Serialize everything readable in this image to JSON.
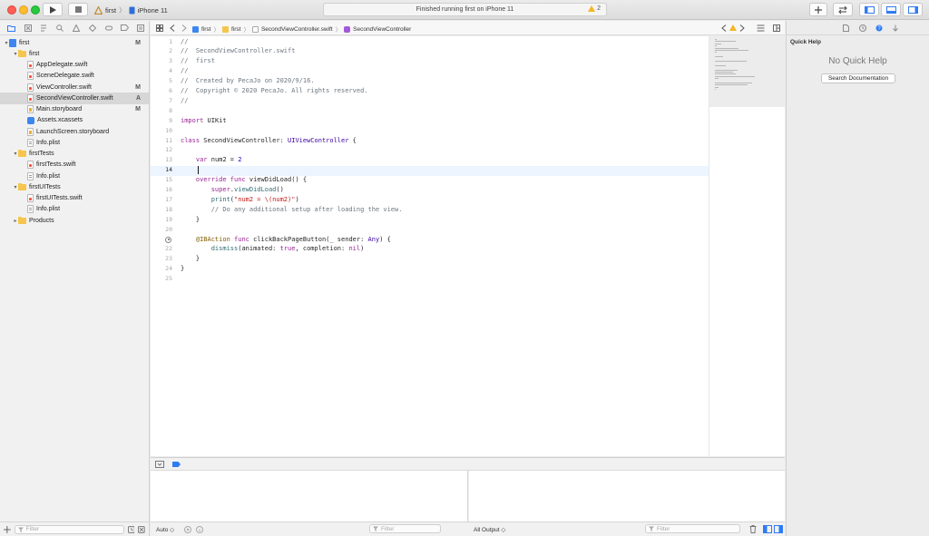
{
  "toolbar": {
    "scheme_name": "first",
    "device_name": "iPhone 11",
    "status": "Finished running first on iPhone 11",
    "warning_count": "2"
  },
  "navigator": {
    "filter_placeholder": "Filter",
    "items": [
      {
        "label": "first",
        "badge": "M",
        "level": 0,
        "kind": "project",
        "open": true
      },
      {
        "label": "first",
        "badge": "",
        "level": 1,
        "kind": "folder",
        "open": true
      },
      {
        "label": "AppDelegate.swift",
        "badge": "",
        "level": 2,
        "kind": "swift"
      },
      {
        "label": "SceneDelegate.swift",
        "badge": "",
        "level": 2,
        "kind": "swift"
      },
      {
        "label": "ViewController.swift",
        "badge": "M",
        "level": 2,
        "kind": "swift"
      },
      {
        "label": "SecondViewController.swift",
        "badge": "A",
        "level": 2,
        "kind": "swift",
        "selected": true
      },
      {
        "label": "Main.storyboard",
        "badge": "M",
        "level": 2,
        "kind": "story"
      },
      {
        "label": "Assets.xcassets",
        "badge": "",
        "level": 2,
        "kind": "assets"
      },
      {
        "label": "LaunchScreen.storyboard",
        "badge": "",
        "level": 2,
        "kind": "story"
      },
      {
        "label": "Info.plist",
        "badge": "",
        "level": 2,
        "kind": "plist"
      },
      {
        "label": "firstTests",
        "badge": "",
        "level": 1,
        "kind": "folder",
        "open": true
      },
      {
        "label": "firstTests.swift",
        "badge": "",
        "level": 2,
        "kind": "swift"
      },
      {
        "label": "Info.plist",
        "badge": "",
        "level": 2,
        "kind": "plist"
      },
      {
        "label": "firstUITests",
        "badge": "",
        "level": 1,
        "kind": "folder",
        "open": true
      },
      {
        "label": "firstUITests.swift",
        "badge": "",
        "level": 2,
        "kind": "swift"
      },
      {
        "label": "Info.plist",
        "badge": "",
        "level": 2,
        "kind": "plist"
      },
      {
        "label": "Products",
        "badge": "",
        "level": 1,
        "kind": "folder",
        "open": false
      }
    ]
  },
  "jumpbar": {
    "crumbs": [
      "first",
      "first",
      "SecondViewController.swift",
      "SecondViewController"
    ]
  },
  "editor": {
    "current_line": 14,
    "breakpoint_line": 21,
    "lines": [
      [
        [
          "c-cm",
          "//"
        ]
      ],
      [
        [
          "c-cm",
          "//  SecondViewController.swift"
        ]
      ],
      [
        [
          "c-cm",
          "//  first"
        ]
      ],
      [
        [
          "c-cm",
          "//"
        ]
      ],
      [
        [
          "c-cm",
          "//  Created by PecaJo on 2020/9/16."
        ]
      ],
      [
        [
          "c-cm",
          "//  Copyright © 2020 PecaJo. All rights reserved."
        ]
      ],
      [
        [
          "c-cm",
          "//"
        ]
      ],
      [],
      [
        [
          "c-kw",
          "import"
        ],
        [
          "",
          " UIKit"
        ]
      ],
      [],
      [
        [
          "c-kw",
          "class"
        ],
        [
          "",
          " SecondViewController: "
        ],
        [
          "c-ty",
          "UIViewController"
        ],
        [
          "",
          " {"
        ]
      ],
      [],
      [
        [
          "",
          "    "
        ],
        [
          "c-kw",
          "var"
        ],
        [
          "",
          " num2 = "
        ],
        [
          "c-num",
          "2"
        ]
      ],
      [],
      [
        [
          "",
          "    "
        ],
        [
          "c-kw",
          "override func"
        ],
        [
          "",
          " viewDidLoad() {"
        ]
      ],
      [
        [
          "",
          "        "
        ],
        [
          "c-kw",
          "super"
        ],
        [
          "",
          "."
        ],
        [
          "c-fn",
          "viewDidLoad"
        ],
        [
          "",
          "()"
        ]
      ],
      [
        [
          "",
          "        "
        ],
        [
          "c-fn",
          "print"
        ],
        [
          "",
          "("
        ],
        [
          "c-str",
          "\"num2 = \\(num2)\""
        ],
        [
          "",
          ")"
        ]
      ],
      [
        [
          "",
          "        "
        ],
        [
          "c-cm",
          "// Do any additional setup after loading the view."
        ]
      ],
      [
        [
          "",
          "    }"
        ]
      ],
      [],
      [
        [
          "",
          "    "
        ],
        [
          "c-attr",
          "@IBAction"
        ],
        [
          "",
          " "
        ],
        [
          "c-kw",
          "func"
        ],
        [
          "",
          " clickBackPageButton(_ sender: "
        ],
        [
          "c-ty",
          "Any"
        ],
        [
          "",
          ") {"
        ]
      ],
      [
        [
          "",
          "        "
        ],
        [
          "c-fn",
          "dismiss"
        ],
        [
          "",
          "(animated: "
        ],
        [
          "c-kw",
          "true"
        ],
        [
          "",
          ", completion: "
        ],
        [
          "c-kw",
          "nil"
        ],
        [
          "",
          ")"
        ]
      ],
      [
        [
          "",
          "    }"
        ]
      ],
      [
        [
          "",
          "}"
        ]
      ],
      []
    ]
  },
  "debug": {
    "auto_label": "Auto ◇",
    "var_filter_placeholder": "Filter",
    "output_label": "All Output ◇",
    "console_filter_placeholder": "Filter"
  },
  "inspector": {
    "title": "Quick Help",
    "empty_text": "No Quick Help",
    "search_button": "Search Documentation"
  }
}
